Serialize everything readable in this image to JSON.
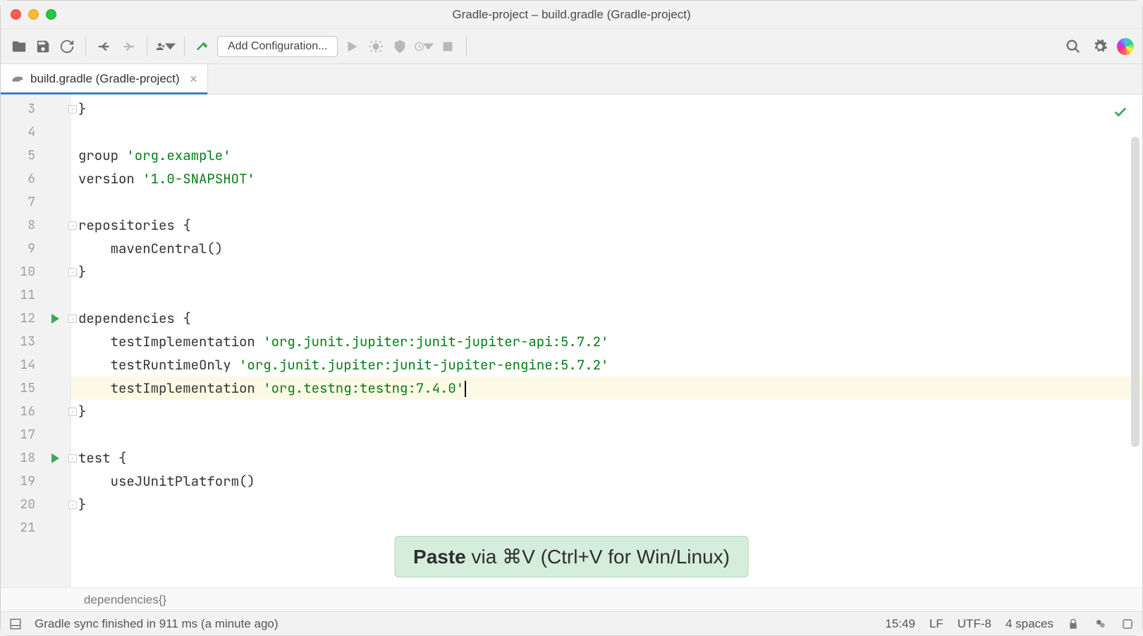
{
  "title": "Gradle-project – build.gradle (Gradle-project)",
  "toolbar": {
    "add_config": "Add Configuration..."
  },
  "tab": {
    "label": "build.gradle (Gradle-project)"
  },
  "gutter": {
    "start": 3,
    "end": 21,
    "runMarkers": [
      12,
      18
    ],
    "foldMarkers": [
      3,
      8,
      10,
      12,
      16,
      18,
      20
    ]
  },
  "code": {
    "lines": [
      {
        "n": 3,
        "tokens": [
          {
            "t": "}",
            "c": "kw"
          }
        ]
      },
      {
        "n": 4,
        "tokens": []
      },
      {
        "n": 5,
        "tokens": [
          {
            "t": "group ",
            "c": "kw"
          },
          {
            "t": "'org.example'",
            "c": "str"
          }
        ]
      },
      {
        "n": 6,
        "tokens": [
          {
            "t": "version ",
            "c": "kw"
          },
          {
            "t": "'1.0-SNAPSHOT'",
            "c": "str"
          }
        ]
      },
      {
        "n": 7,
        "tokens": []
      },
      {
        "n": 8,
        "tokens": [
          {
            "t": "repositories {",
            "c": "kw"
          }
        ]
      },
      {
        "n": 9,
        "tokens": [
          {
            "t": "    mavenCentral()",
            "c": "kw"
          }
        ]
      },
      {
        "n": 10,
        "tokens": [
          {
            "t": "}",
            "c": "kw"
          }
        ]
      },
      {
        "n": 11,
        "tokens": []
      },
      {
        "n": 12,
        "tokens": [
          {
            "t": "dependencies {",
            "c": "kw"
          }
        ]
      },
      {
        "n": 13,
        "tokens": [
          {
            "t": "    testImplementation ",
            "c": "kw"
          },
          {
            "t": "'org.junit.jupiter:junit-jupiter-api:5.7.2'",
            "c": "str"
          }
        ]
      },
      {
        "n": 14,
        "tokens": [
          {
            "t": "    testRuntimeOnly ",
            "c": "kw"
          },
          {
            "t": "'org.junit.jupiter:junit-jupiter-engine:5.7.2'",
            "c": "str"
          }
        ]
      },
      {
        "n": 15,
        "hl": true,
        "caret": true,
        "tokens": [
          {
            "t": "    testImplementation ",
            "c": "kw"
          },
          {
            "t": "'org.testng:testng:7.4.0'",
            "c": "str"
          }
        ]
      },
      {
        "n": 16,
        "tokens": [
          {
            "t": "}",
            "c": "kw"
          }
        ]
      },
      {
        "n": 17,
        "tokens": []
      },
      {
        "n": 18,
        "tokens": [
          {
            "t": "test {",
            "c": "kw"
          }
        ]
      },
      {
        "n": 19,
        "tokens": [
          {
            "t": "    useJUnitPlatform()",
            "c": "kw"
          }
        ]
      },
      {
        "n": 20,
        "tokens": [
          {
            "t": "}",
            "c": "kw"
          }
        ]
      },
      {
        "n": 21,
        "tokens": []
      }
    ]
  },
  "breadcrumb": "dependencies{}",
  "status": {
    "message": "Gradle sync finished in 911 ms (a minute ago)",
    "pos": "15:49",
    "lineSep": "LF",
    "encoding": "UTF-8",
    "indent": "4 spaces"
  },
  "toast": {
    "bold": "Paste",
    "rest": " via ⌘V (Ctrl+V for Win/Linux)"
  }
}
